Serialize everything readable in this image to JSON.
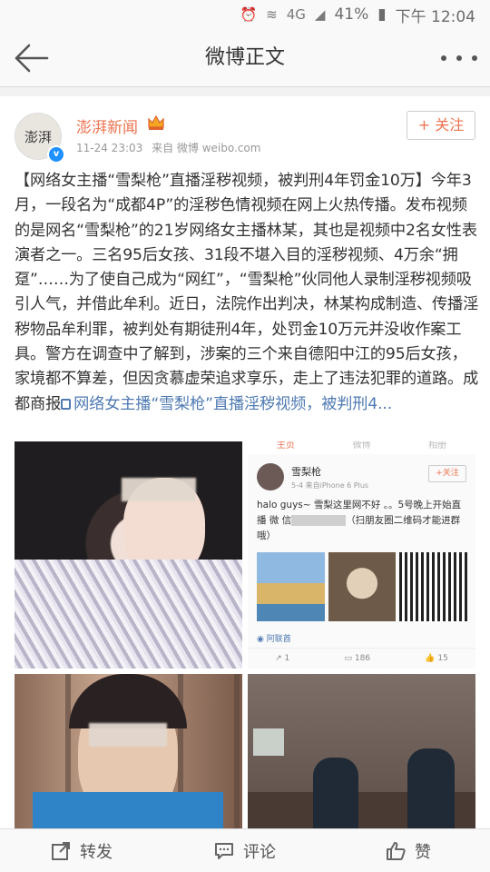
{
  "status_bar": {
    "network": "4G",
    "battery": "41%",
    "time": "下午 12:04"
  },
  "nav": {
    "title": "微博正文"
  },
  "post": {
    "author": {
      "name": "澎湃新闻",
      "avatar_text": "澎湃"
    },
    "time": "11-24 23:03",
    "source": "来自 微博 weibo.com",
    "follow_label": "+ 关注",
    "text": "【网络女主播“雪梨枪”直播淫秽视频，被判刑4年罚金10万】今年3月，一段名为“成都4P”的淫秽色情视频在网上火热传播。发布视频的是网名“雪梨枪”的21岁网络女主播林某，其也是视频中2名女性表演者之一。三名95后女孩、31段不堪入目的淫秽视频、4万余“拥趸”……为了使自己成为“网红”，“雪梨枪”伙同他人录制淫秽视频吸引人气，并借此牟利。近日，法院作出判决，林某构成制造、传播淫秽物品牟利罪，被判处有期徒刑4年，处罚金10万元并没收作案工具。警方在调查中了解到，涉案的三个来自德阳中江的95后女孩，家境都不算差，但因贪慕虚荣追求享乐，走上了违法犯罪的道路。成都商报",
    "link_text": "网络女主播“雪梨枪”直播淫秽视频，被判刑4..."
  },
  "embedded_screenshot": {
    "tabs": [
      "主页",
      "微博",
      "相册"
    ],
    "user": "雪梨枪",
    "source": "5-4 来自iPhone 6 Plus",
    "follow": "+关注",
    "text_a": "halo guys~ 雪梨这里网不好 。。5号晚上开始直播 微 信",
    "text_b": "（扫朋友圈二维码才能进群哦）",
    "location": "阿联酋",
    "reposts": "1",
    "comments": "186",
    "likes": "15"
  },
  "toolbar": {
    "repost": "转发",
    "comment": "评论",
    "like": "赞"
  },
  "icons": [
    "signal-icon",
    "battery-icon",
    "back-arrow-icon",
    "more-icon",
    "crown-icon",
    "verified-icon",
    "link-icon",
    "repost-icon",
    "comment-icon",
    "like-icon"
  ],
  "colors": {
    "accent": "#eb7350",
    "link": "#4f7ab2"
  }
}
